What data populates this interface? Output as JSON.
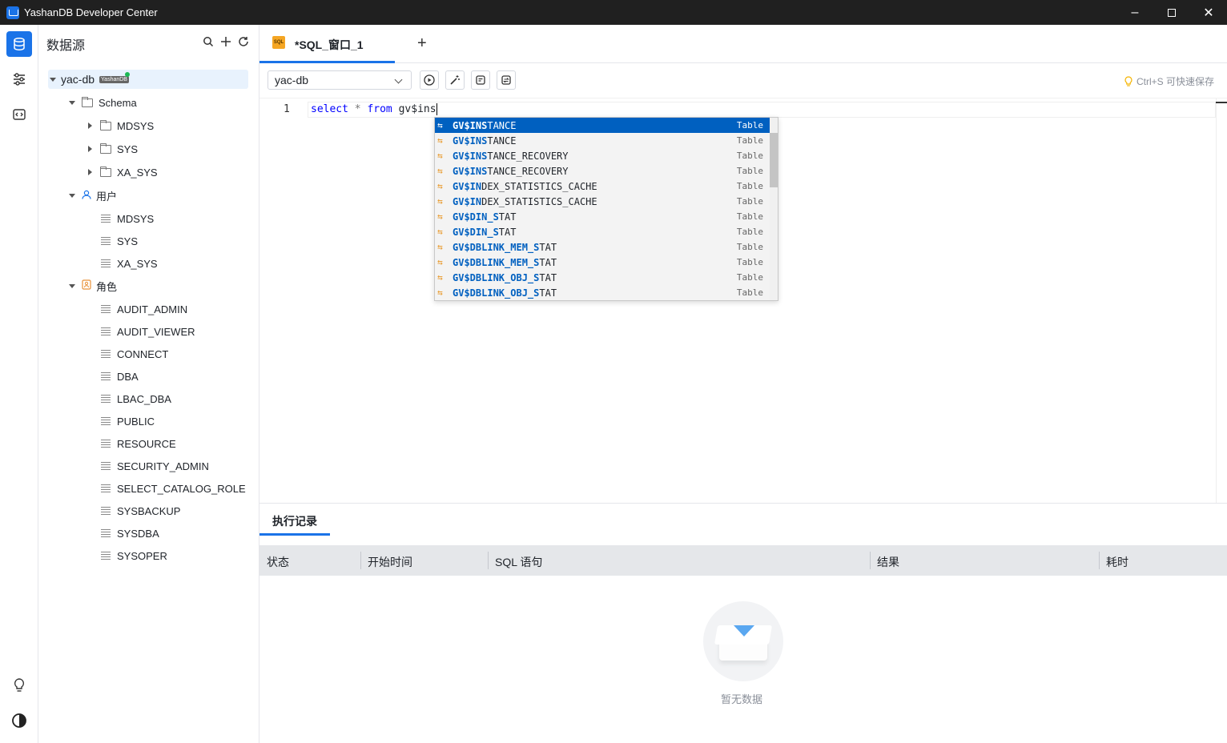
{
  "window": {
    "title": "YashanDB Developer Center"
  },
  "sidebar": {
    "header": "数据源",
    "connection": {
      "name": "yac-db",
      "badge": "YashanDB"
    },
    "schema_label": "Schema",
    "schemas": [
      "MDSYS",
      "SYS",
      "XA_SYS"
    ],
    "users_label": "用户",
    "users": [
      "MDSYS",
      "SYS",
      "XA_SYS"
    ],
    "roles_label": "角色",
    "roles": [
      "AUDIT_ADMIN",
      "AUDIT_VIEWER",
      "CONNECT",
      "DBA",
      "LBAC_DBA",
      "PUBLIC",
      "RESOURCE",
      "SECURITY_ADMIN",
      "SELECT_CATALOG_ROLE",
      "SYSBACKUP",
      "SYSDBA",
      "SYSOPER"
    ]
  },
  "editor_tab": {
    "label": "*SQL_窗口_1",
    "icon_text": "SQL"
  },
  "toolbar": {
    "datasource_selected": "yac-db",
    "hint": "Ctrl+S 可快速保存"
  },
  "editor": {
    "line_number": "1",
    "code": {
      "kw1": "select",
      "star": "*",
      "kw2": "from",
      "rest": "gv$ins"
    }
  },
  "autocomplete": {
    "kind": "Table",
    "items": [
      {
        "pre": "GV$INS",
        "post": "TANCE"
      },
      {
        "pre": "GV$INS",
        "post": "TANCE"
      },
      {
        "pre": "GV$INS",
        "post": "TANCE_RECOVERY"
      },
      {
        "pre": "GV$INS",
        "post": "TANCE_RECOVERY"
      },
      {
        "pre": "GV$IN",
        "post": "DEX_STATISTICS_CACHE"
      },
      {
        "pre": "GV$IN",
        "post": "DEX_STATISTICS_CACHE"
      },
      {
        "pre": "GV$DIN_S",
        "post": "TAT"
      },
      {
        "pre": "GV$DIN_S",
        "post": "TAT"
      },
      {
        "pre": "GV$DBLINK_MEM_S",
        "post": "TAT"
      },
      {
        "pre": "GV$DBLINK_MEM_S",
        "post": "TAT"
      },
      {
        "pre": "GV$DBLINK_OBJ_S",
        "post": "TAT"
      },
      {
        "pre": "GV$DBLINK_OBJ_S",
        "post": "TAT"
      }
    ]
  },
  "history": {
    "tab_label": "执行记录",
    "columns": [
      "状态",
      "开始时间",
      "SQL 语句",
      "结果",
      "耗时"
    ],
    "empty_text": "暂无数据"
  },
  "colors": {
    "accent": "#1a73e8",
    "selection": "#0060c0",
    "keyword": "#0000ff"
  }
}
